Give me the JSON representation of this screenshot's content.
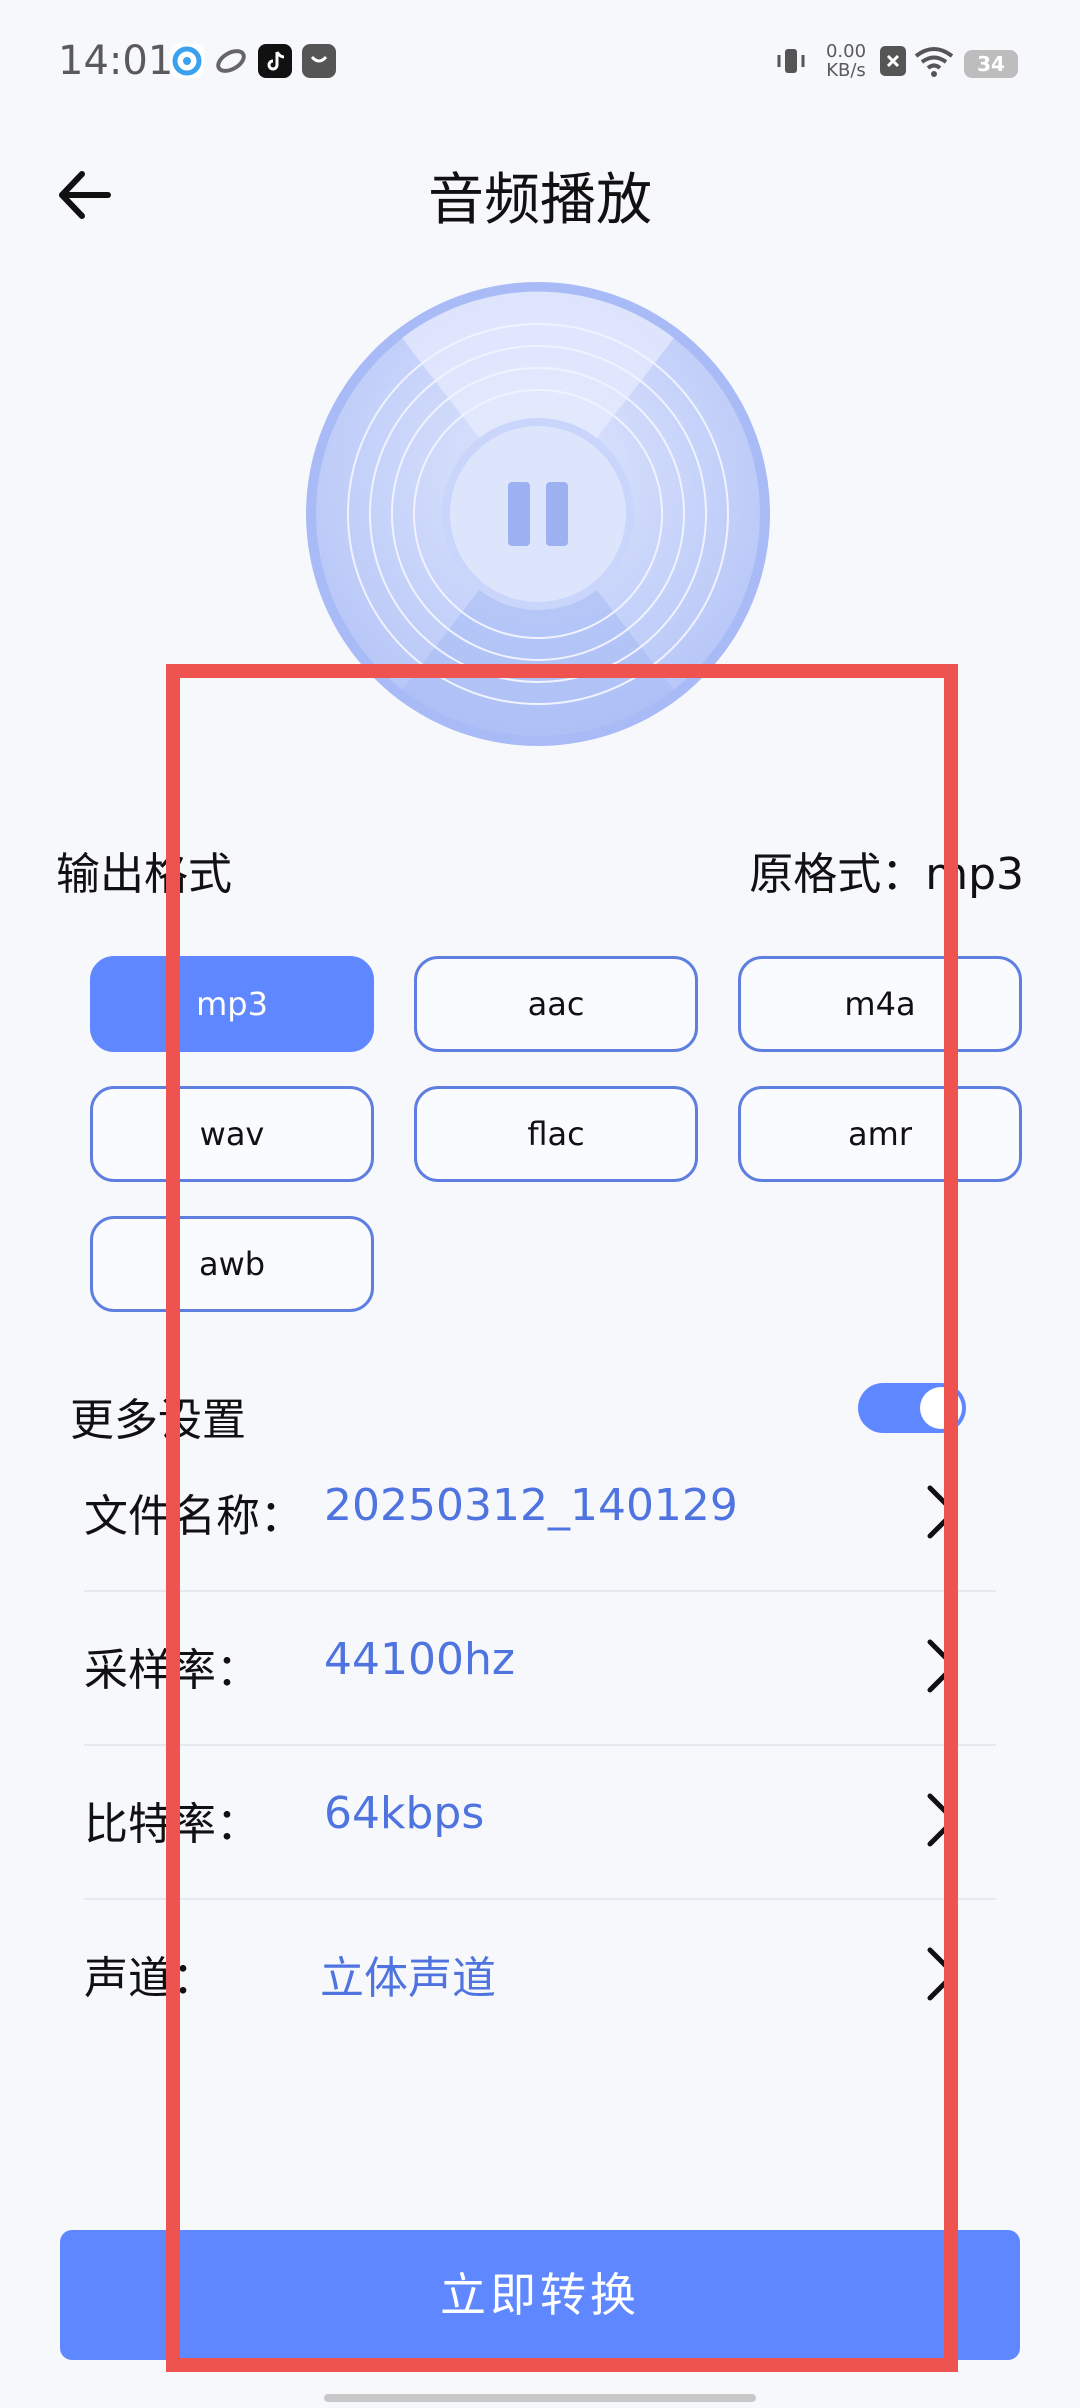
{
  "status": {
    "time": "14:01",
    "net_speed_value": "0.00",
    "net_speed_unit": "KB/s",
    "battery": "34",
    "icons": [
      "browser-icon",
      "cloud-app-icon",
      "tiktok-icon",
      "message-app-icon",
      "vibrate-icon",
      "sim-off-icon",
      "wifi-icon",
      "battery-icon"
    ]
  },
  "header": {
    "title": "音频播放",
    "back_icon": "arrow-left-icon"
  },
  "player": {
    "state_icon": "pause-icon"
  },
  "format_section": {
    "label": "输出格式",
    "original_format": "原格式：mp3",
    "options": [
      "mp3",
      "aac",
      "m4a",
      "wav",
      "flac",
      "amr",
      "awb"
    ],
    "selected": "mp3"
  },
  "more_settings": {
    "label": "更多设置",
    "toggle_on": true,
    "rows": [
      {
        "label": "文件名称：",
        "value": "20250312_140129"
      },
      {
        "label": "采样率：",
        "value": "44100hz"
      },
      {
        "label": "比特率：",
        "value": "64kbps"
      },
      {
        "label": "声道：",
        "value": "立体声道"
      }
    ]
  },
  "convert_button": {
    "label": "立即转换"
  },
  "colors": {
    "accent": "#5f87ff",
    "value_text": "#4f74e0",
    "annotation": "#ef5350"
  }
}
